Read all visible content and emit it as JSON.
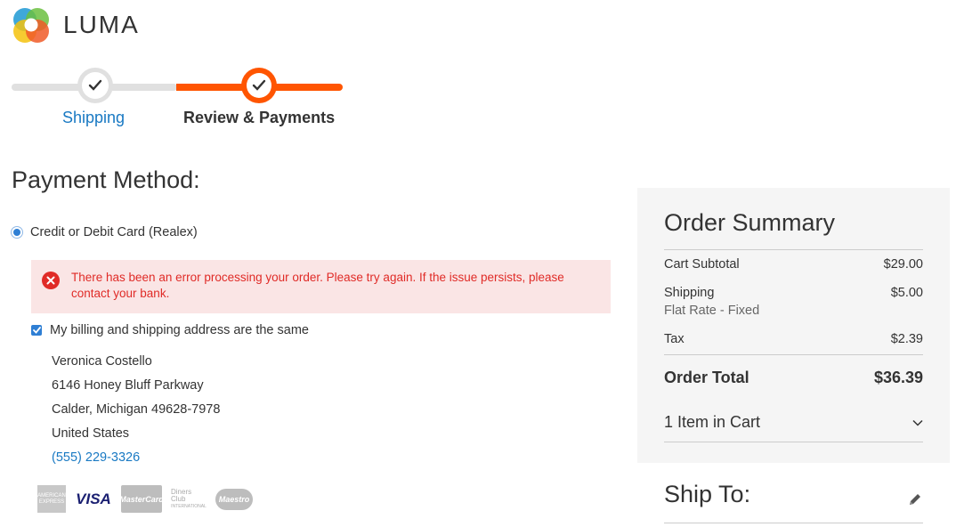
{
  "brand": {
    "name": "LUMA"
  },
  "progress": {
    "steps": [
      {
        "label": "Shipping",
        "state": "complete"
      },
      {
        "label": "Review & Payments",
        "state": "active"
      }
    ],
    "accent_color": "#ff5501"
  },
  "payment": {
    "title": "Payment Method:",
    "method_label": "Credit or Debit Card (Realex)",
    "error_message": "There has been an error processing your order. Please try again. If the issue persists, please contact your bank.",
    "same_address_label": "My billing and shipping address are the same",
    "address": {
      "name": "Veronica Costello",
      "street": "6146 Honey Bluff Parkway",
      "city_line": "Calder, Michigan 49628-7978",
      "country": "United States",
      "phone": "(555) 229-3326"
    },
    "card_icons": [
      "amex-icon",
      "visa-icon",
      "mastercard-icon",
      "diners-club-icon",
      "maestro-icon"
    ],
    "card_texts": {
      "amex": "AMERICAN EXPRESS",
      "visa": "VISA",
      "mastercard": "MasterCard",
      "diners_line1": "Diners Club",
      "diners_line2": "INTERNATIONAL",
      "maestro": "Maestro"
    }
  },
  "order_summary": {
    "title": "Order Summary",
    "cart_subtotal_label": "Cart Subtotal",
    "cart_subtotal_value": "$29.00",
    "shipping_label": "Shipping",
    "shipping_method": "Flat Rate - Fixed",
    "shipping_value": "$5.00",
    "tax_label": "Tax",
    "tax_value": "$2.39",
    "order_total_label": "Order Total",
    "order_total_value": "$36.39",
    "items_in_cart": "1 Item in Cart"
  },
  "ship_to": {
    "title": "Ship To:"
  },
  "colors": {
    "link": "#1979c3",
    "error": "#e02b27",
    "error_bg": "#fae5e5",
    "summary_bg": "#f5f5f5"
  }
}
